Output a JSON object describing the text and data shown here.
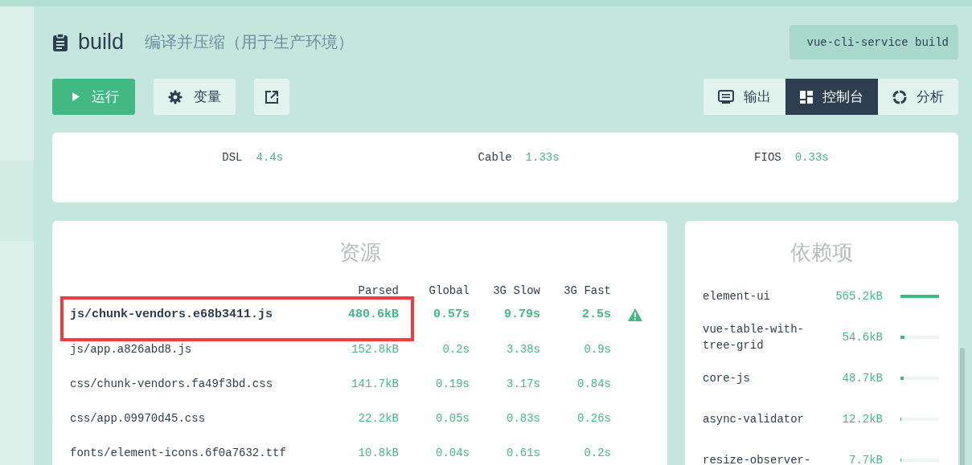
{
  "task": {
    "name": "build",
    "description": "编译并压缩（用于生产环境）",
    "command": "vue-cli-service build"
  },
  "actions": [
    {
      "kind": "run",
      "label": "运行"
    },
    {
      "kind": "variables",
      "label": "变量"
    },
    {
      "kind": "open"
    }
  ],
  "views": [
    {
      "kind": "output",
      "label": "输出",
      "selected": false
    },
    {
      "kind": "dashboard",
      "label": "控制台",
      "selected": true
    },
    {
      "kind": "analyzer",
      "label": "分析",
      "selected": false
    }
  ],
  "speeds": [
    {
      "name": "DSL",
      "value": "4.4s"
    },
    {
      "name": "Cable",
      "value": "1.33s"
    },
    {
      "name": "FIOS",
      "value": "0.33s"
    }
  ],
  "assets": {
    "title": "资源",
    "columns": [
      "Parsed",
      "Global",
      "3G Slow",
      "3G Fast"
    ],
    "rows": [
      {
        "name": "js/chunk-vendors.e68b3411.js",
        "values": [
          "480.6kB",
          "0.57s",
          "9.79s",
          "2.5s"
        ],
        "warning": true,
        "highlighted": true
      },
      {
        "name": "js/app.a826abd8.js",
        "values": [
          "152.8kB",
          "0.2s",
          "3.38s",
          "0.9s"
        ],
        "warning": false,
        "highlighted": false
      },
      {
        "name": "css/chunk-vendors.fa49f3bd.css",
        "values": [
          "141.7kB",
          "0.19s",
          "3.17s",
          "0.84s"
        ],
        "warning": false,
        "highlighted": false
      },
      {
        "name": "css/app.09970d45.css",
        "values": [
          "22.2kB",
          "0.05s",
          "0.83s",
          "0.26s"
        ],
        "warning": false,
        "highlighted": false
      },
      {
        "name": "fonts/element-icons.6f0a7632.ttf",
        "values": [
          "10.8kB",
          "0.04s",
          "0.61s",
          "0.2s"
        ],
        "warning": false,
        "highlighted": false
      }
    ]
  },
  "dependencies": {
    "title": "依赖项",
    "items": [
      {
        "name": "element-ui",
        "size": "565.2kB",
        "level": 1.0
      },
      {
        "name": "vue-table-with-tree-grid",
        "size": "54.6kB",
        "level": 0.1
      },
      {
        "name": "core-js",
        "size": "48.7kB",
        "level": 0.09
      },
      {
        "name": "async-validator",
        "size": "12.2kB",
        "level": 0.02
      },
      {
        "name": "resize-observer-",
        "size": "7.7kB",
        "level": 0.014
      }
    ]
  }
}
